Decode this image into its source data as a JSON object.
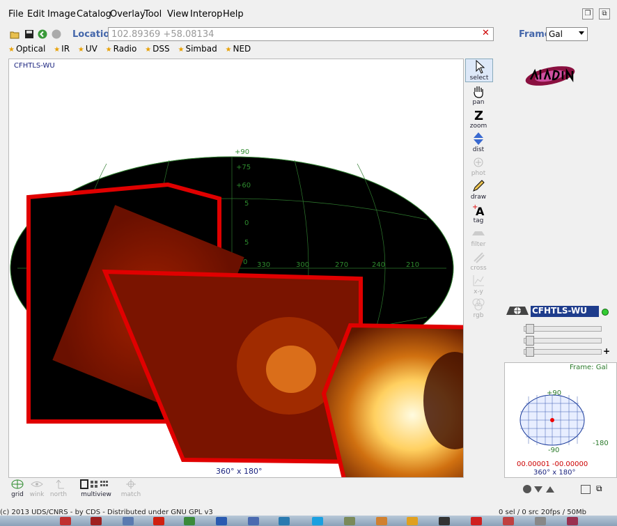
{
  "menu": [
    "File",
    "Edit",
    "Image",
    "Catalog",
    "Overlay",
    "Tool",
    "View",
    "Interop",
    "Help"
  ],
  "location": {
    "label": "Location",
    "value": "102.89369 +58.08134",
    "clear": "✕"
  },
  "frame": {
    "label": "Frame",
    "selected": "Gal"
  },
  "bookmarks": [
    "Optical",
    "IR",
    "UV",
    "Radio",
    "DSS",
    "Simbad",
    "NED"
  ],
  "view": {
    "label": "CFHTLS-WU",
    "fov": "360° x 180°",
    "grid_labels": {
      "lat": [
        "+90",
        "+75",
        "+60",
        "5",
        "0",
        "5",
        "0"
      ],
      "lon": [
        "330",
        "300",
        "270",
        "240",
        "210"
      ]
    }
  },
  "tools": [
    {
      "name": "select",
      "label": "select"
    },
    {
      "name": "pan",
      "label": "pan"
    },
    {
      "name": "zoom",
      "label": "zoom"
    },
    {
      "name": "dist",
      "label": "dist"
    },
    {
      "name": "phot",
      "label": "phot"
    },
    {
      "name": "draw",
      "label": "draw"
    },
    {
      "name": "tag",
      "label": "tag"
    },
    {
      "name": "filter",
      "label": "filter"
    },
    {
      "name": "cross",
      "label": "cross"
    },
    {
      "name": "xy",
      "label": "x-y"
    },
    {
      "name": "rgb",
      "label": "rgb"
    }
  ],
  "stack": {
    "name": "CFHTLS-WU"
  },
  "mini": {
    "frame": "Frame: Gal",
    "top": "+90",
    "bottom": "-90",
    "right": "-180",
    "coords": "00.00001 -00.00000",
    "fov": "360° x 180°"
  },
  "bottom_tools": [
    {
      "name": "grid",
      "label": "grid"
    },
    {
      "name": "wink",
      "label": "wink"
    },
    {
      "name": "north",
      "label": "north"
    },
    {
      "name": "multiview",
      "label": "multiview"
    },
    {
      "name": "match",
      "label": "match"
    }
  ],
  "status": {
    "left": "(c) 2013 UDS/CNRS - by CDS - Distributed under GNU GPL v3",
    "right": "0 sel / 0 src   20fps / 50Mb"
  },
  "colors": {
    "accent": "#4466aa",
    "highlight": "#e00000",
    "panel": "#1e3c8c",
    "grid": "#2e8b2e"
  }
}
